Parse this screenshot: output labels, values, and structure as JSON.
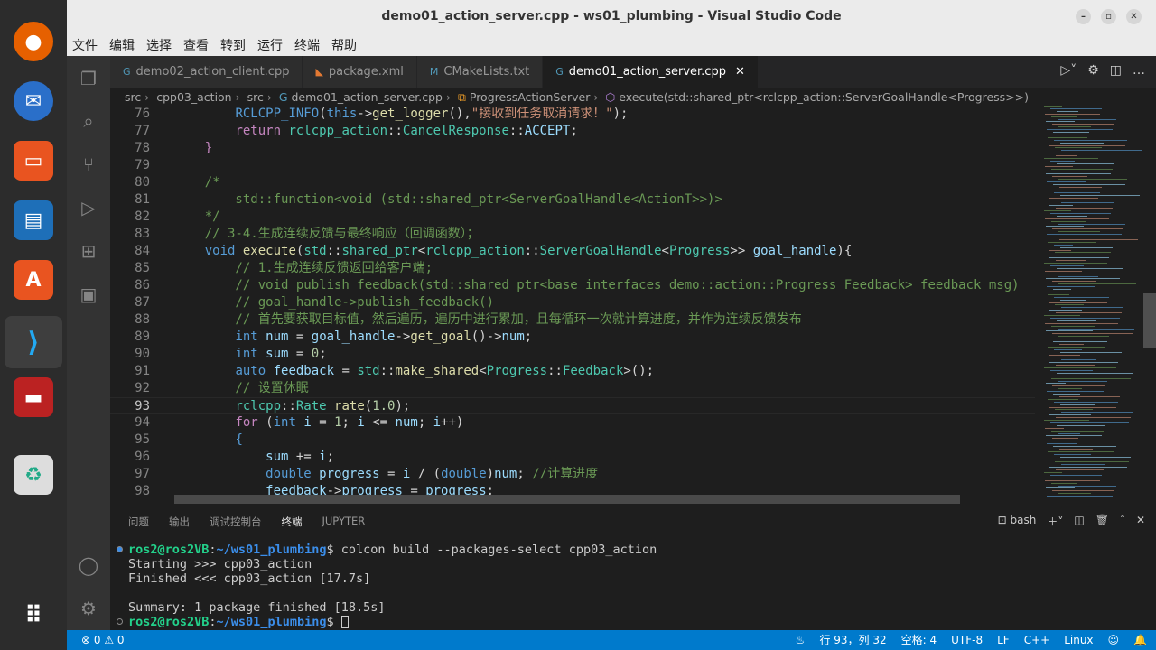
{
  "window": {
    "title": "demo01_action_server.cpp - ws01_plumbing - Visual Studio Code"
  },
  "menu": [
    "文件",
    "编辑",
    "选择",
    "查看",
    "转到",
    "运行",
    "终端",
    "帮助"
  ],
  "tabs": [
    {
      "label": "demo02_action_client.cpp",
      "icon": "cpp-icon"
    },
    {
      "label": "package.xml",
      "icon": "xml-icon"
    },
    {
      "label": "CMakeLists.txt",
      "icon": "cmake-icon"
    },
    {
      "label": "demo01_action_server.cpp",
      "icon": "cpp-icon",
      "active": true
    }
  ],
  "breadcrumb": [
    "src",
    "cpp03_action",
    "src",
    "demo01_action_server.cpp",
    "ProgressActionServer",
    "execute(std::shared_ptr<rclcpp_action::ServerGoalHandle<Progress>>)"
  ],
  "editor": {
    "current_line": 93,
    "lines": [
      {
        "n": 76,
        "t": [
          [
            "p",
            "        "
          ],
          [
            "m",
            "RCLCPP_INFO"
          ],
          [
            "p",
            "("
          ],
          [
            "k",
            "this"
          ],
          [
            "p",
            "->"
          ],
          [
            "f",
            "get_logger"
          ],
          [
            "p",
            "(),"
          ],
          [
            "s",
            "\"接收到任务取消请求！\""
          ],
          [
            "p",
            ");"
          ]
        ]
      },
      {
        "n": 77,
        "t": [
          [
            "p",
            "        "
          ],
          [
            "kc",
            "return"
          ],
          [
            "p",
            " "
          ],
          [
            "t",
            "rclcpp_action"
          ],
          [
            "p",
            "::"
          ],
          [
            "t",
            "CancelResponse"
          ],
          [
            "p",
            "::"
          ],
          [
            "v",
            "ACCEPT"
          ],
          [
            "p",
            ";"
          ]
        ]
      },
      {
        "n": 78,
        "t": [
          [
            "p",
            "    "
          ],
          [
            "kc",
            "}"
          ]
        ]
      },
      {
        "n": 79,
        "t": []
      },
      {
        "n": 80,
        "t": [
          [
            "p",
            "    "
          ],
          [
            "c",
            "/*"
          ]
        ]
      },
      {
        "n": 81,
        "t": [
          [
            "c",
            "        std::function<void (std::shared_ptr<ServerGoalHandle<ActionT>>)>"
          ]
        ]
      },
      {
        "n": 82,
        "t": [
          [
            "c",
            "    */"
          ]
        ]
      },
      {
        "n": 83,
        "t": [
          [
            "c",
            "    // 3-4.生成连续反馈与最终响应（回调函数）；"
          ]
        ]
      },
      {
        "n": 84,
        "t": [
          [
            "p",
            "    "
          ],
          [
            "k",
            "void"
          ],
          [
            "p",
            " "
          ],
          [
            "f",
            "execute"
          ],
          [
            "p",
            "("
          ],
          [
            "t",
            "std"
          ],
          [
            "p",
            "::"
          ],
          [
            "t",
            "shared_ptr"
          ],
          [
            "p",
            "<"
          ],
          [
            "t",
            "rclcpp_action"
          ],
          [
            "p",
            "::"
          ],
          [
            "t",
            "ServerGoalHandle"
          ],
          [
            "p",
            "<"
          ],
          [
            "t",
            "Progress"
          ],
          [
            "p",
            ">> "
          ],
          [
            "v",
            "goal_handle"
          ],
          [
            "p",
            "){"
          ]
        ]
      },
      {
        "n": 85,
        "t": [
          [
            "c",
            "        // 1.生成连续反馈返回给客户端;"
          ]
        ]
      },
      {
        "n": 86,
        "t": [
          [
            "c",
            "        // void publish_feedback(std::shared_ptr<base_interfaces_demo::action::Progress_Feedback> feedback_msg)"
          ]
        ]
      },
      {
        "n": 87,
        "t": [
          [
            "c",
            "        // goal_handle->publish_feedback()"
          ]
        ]
      },
      {
        "n": 88,
        "t": [
          [
            "c",
            "        // 首先要获取目标值，然后遍历，遍历中进行累加，且每循环一次就计算进度，并作为连续反馈发布"
          ]
        ]
      },
      {
        "n": 89,
        "t": [
          [
            "p",
            "        "
          ],
          [
            "k",
            "int"
          ],
          [
            "p",
            " "
          ],
          [
            "v",
            "num"
          ],
          [
            "p",
            " = "
          ],
          [
            "v",
            "goal_handle"
          ],
          [
            "p",
            "->"
          ],
          [
            "f",
            "get_goal"
          ],
          [
            "p",
            "()->"
          ],
          [
            "v",
            "num"
          ],
          [
            "p",
            ";"
          ]
        ]
      },
      {
        "n": 90,
        "t": [
          [
            "p",
            "        "
          ],
          [
            "k",
            "int"
          ],
          [
            "p",
            " "
          ],
          [
            "v",
            "sum"
          ],
          [
            "p",
            " = "
          ],
          [
            "n",
            "0"
          ],
          [
            "p",
            ";"
          ]
        ]
      },
      {
        "n": 91,
        "t": [
          [
            "p",
            "        "
          ],
          [
            "k",
            "auto"
          ],
          [
            "p",
            " "
          ],
          [
            "v",
            "feedback"
          ],
          [
            "p",
            " = "
          ],
          [
            "t",
            "std"
          ],
          [
            "p",
            "::"
          ],
          [
            "f",
            "make_shared"
          ],
          [
            "p",
            "<"
          ],
          [
            "t",
            "Progress"
          ],
          [
            "p",
            "::"
          ],
          [
            "t",
            "Feedback"
          ],
          [
            "p",
            ">();"
          ]
        ]
      },
      {
        "n": 92,
        "t": [
          [
            "c",
            "        // 设置休眠"
          ]
        ]
      },
      {
        "n": 93,
        "t": [
          [
            "p",
            "        "
          ],
          [
            "t",
            "rclcpp"
          ],
          [
            "p",
            "::"
          ],
          [
            "t",
            "Rate"
          ],
          [
            "p",
            " "
          ],
          [
            "f",
            "rate"
          ],
          [
            "p",
            "("
          ],
          [
            "n",
            "1.0"
          ],
          [
            "p",
            ");"
          ]
        ]
      },
      {
        "n": 94,
        "t": [
          [
            "p",
            "        "
          ],
          [
            "kc",
            "for"
          ],
          [
            "p",
            " ("
          ],
          [
            "k",
            "int"
          ],
          [
            "p",
            " "
          ],
          [
            "v",
            "i"
          ],
          [
            "p",
            " = "
          ],
          [
            "n",
            "1"
          ],
          [
            "p",
            "; "
          ],
          [
            "v",
            "i"
          ],
          [
            "p",
            " <= "
          ],
          [
            "v",
            "num"
          ],
          [
            "p",
            "; "
          ],
          [
            "v",
            "i"
          ],
          [
            "p",
            "++)"
          ]
        ]
      },
      {
        "n": 95,
        "t": [
          [
            "p",
            "        "
          ],
          [
            "k",
            "{"
          ]
        ]
      },
      {
        "n": 96,
        "t": [
          [
            "p",
            "            "
          ],
          [
            "v",
            "sum"
          ],
          [
            "p",
            " += "
          ],
          [
            "v",
            "i"
          ],
          [
            "p",
            ";"
          ]
        ]
      },
      {
        "n": 97,
        "t": [
          [
            "p",
            "            "
          ],
          [
            "k",
            "double"
          ],
          [
            "p",
            " "
          ],
          [
            "v",
            "progress"
          ],
          [
            "p",
            " = "
          ],
          [
            "v",
            "i"
          ],
          [
            "p",
            " / ("
          ],
          [
            "k",
            "double"
          ],
          [
            "p",
            ")"
          ],
          [
            "v",
            "num"
          ],
          [
            "p",
            "; "
          ],
          [
            "c",
            "//计算进度"
          ]
        ]
      },
      {
        "n": 98,
        "t": [
          [
            "p",
            "            "
          ],
          [
            "v",
            "feedback"
          ],
          [
            "p",
            "->"
          ],
          [
            "v",
            "progress"
          ],
          [
            "p",
            " = "
          ],
          [
            "v",
            "progress"
          ],
          [
            "p",
            ";"
          ]
        ]
      }
    ]
  },
  "panel": {
    "tabs": [
      "问题",
      "输出",
      "调试控制台",
      "终端",
      "JUPYTER"
    ],
    "active_tab": "终端",
    "shell": "bash",
    "terminal": [
      {
        "user": "ros2@ros2VB",
        "path": "~/ws01_plumbing",
        "cmd": " colcon build --packages-select cpp03_action"
      },
      {
        "text": "Starting >>> cpp03_action"
      },
      {
        "text": "Finished <<< cpp03_action [17.7s]"
      },
      {
        "text": ""
      },
      {
        "text": "Summary: 1 package finished [18.5s]"
      },
      {
        "user": "ros2@ros2VB",
        "path": "~/ws01_plumbing",
        "cmd": " "
      }
    ]
  },
  "status": {
    "errors": "0",
    "warnings": "0",
    "position": "行 93，列 32",
    "indent": "空格: 4",
    "encoding": "UTF-8",
    "eol": "LF",
    "language": "C++",
    "platform": "Linux"
  },
  "accent": "#007acc"
}
